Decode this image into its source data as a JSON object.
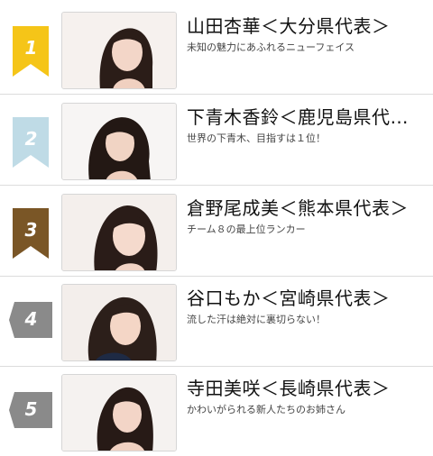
{
  "colors": {
    "gold": "#f5c518",
    "silver": "#bfdbe6",
    "bronze": "#7a5626",
    "gray": "#8a8a8a",
    "divider": "#dcdcdc"
  },
  "ranking": [
    {
      "rank": "1",
      "badge_style": "ribbon",
      "badge_color": "#f5c518",
      "photo_icon": "portrait-photo",
      "name": "山田杏華＜大分県代表＞",
      "tagline": "未知の魅力にあふれるニューフェイス"
    },
    {
      "rank": "2",
      "badge_style": "ribbon",
      "badge_color": "#bfdbe6",
      "photo_icon": "portrait-photo",
      "name": "下青木香鈴＜鹿児島県代…",
      "tagline": "世界の下青木、目指すは１位！"
    },
    {
      "rank": "3",
      "badge_style": "ribbon",
      "badge_color": "#7a5626",
      "photo_icon": "portrait-photo",
      "name": "倉野尾成美＜熊本県代表＞",
      "tagline": "チーム８の最上位ランカー"
    },
    {
      "rank": "4",
      "badge_style": "tag",
      "badge_color": "#8a8a8a",
      "photo_icon": "portrait-photo",
      "name": "谷口もか＜宮崎県代表＞",
      "tagline": "流した汗は絶対に裏切らない！"
    },
    {
      "rank": "5",
      "badge_style": "tag",
      "badge_color": "#8a8a8a",
      "photo_icon": "portrait-photo",
      "name": "寺田美咲＜長崎県代表＞",
      "tagline": "かわいがられる新人たちのお姉さん"
    }
  ]
}
